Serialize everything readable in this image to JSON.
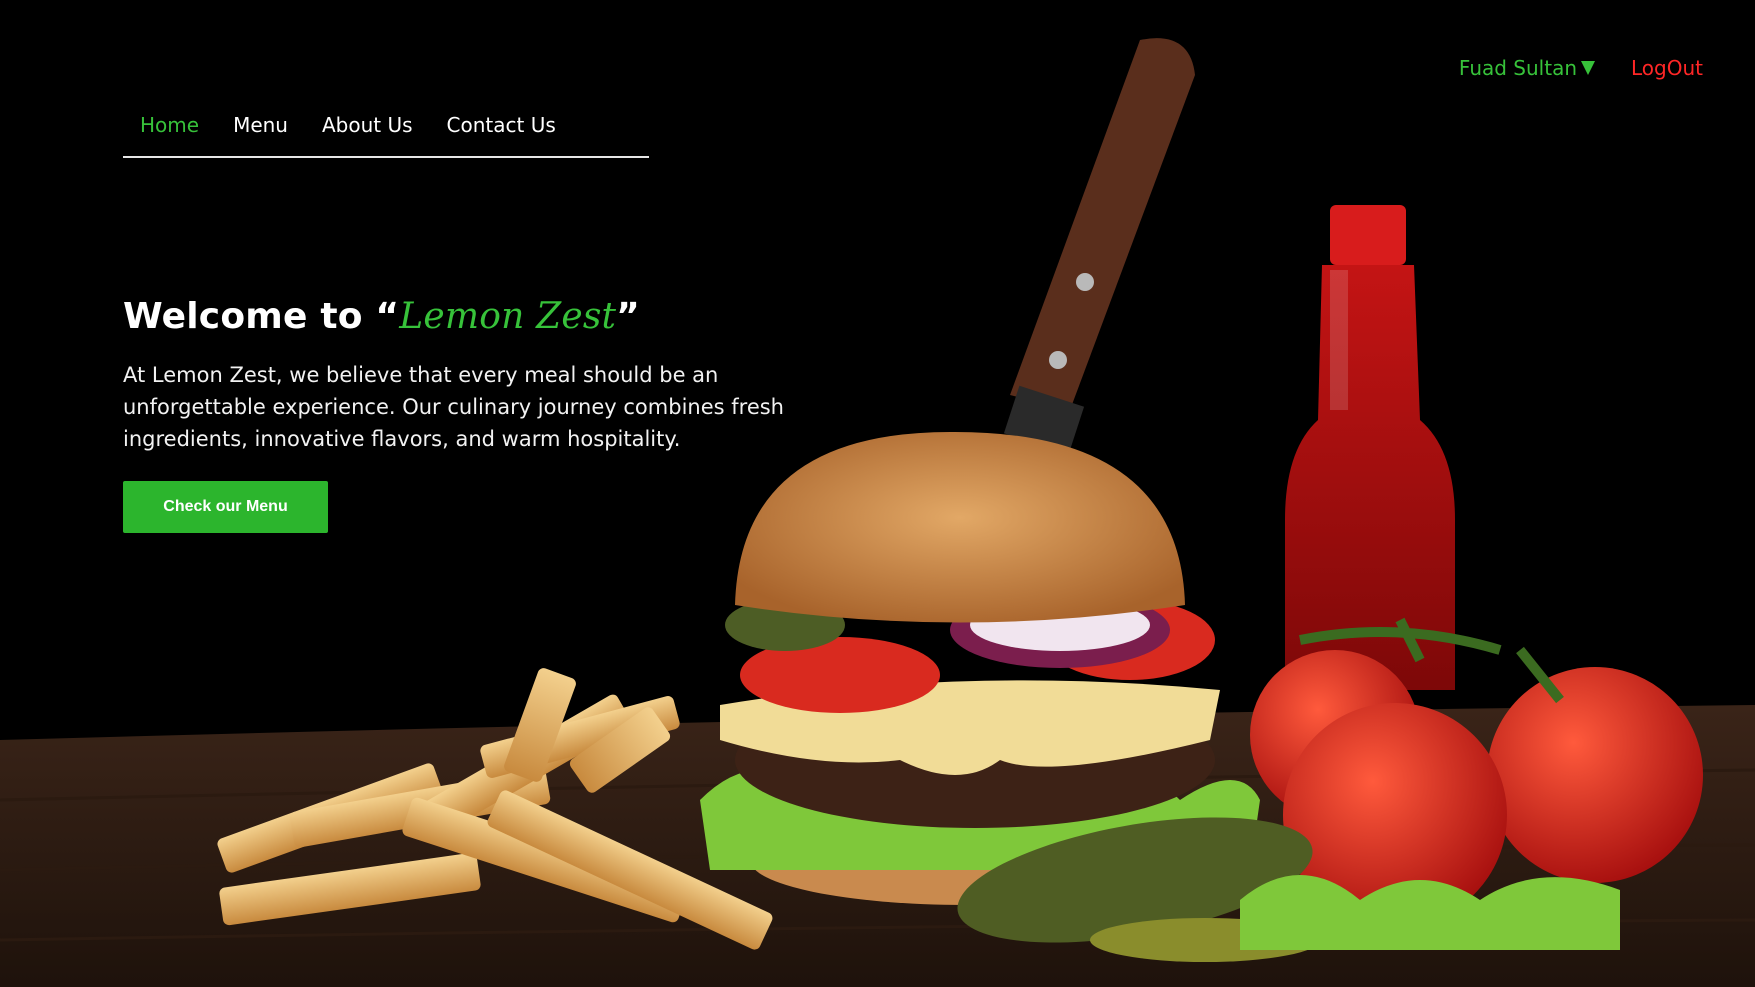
{
  "nav": {
    "items": [
      {
        "label": "Home",
        "active": true
      },
      {
        "label": "Menu",
        "active": false
      },
      {
        "label": "About Us",
        "active": false
      },
      {
        "label": "Contact Us",
        "active": false
      }
    ]
  },
  "user": {
    "name": "Fuad Sultan",
    "dropdown_icon": "caret-down-icon",
    "logout_label": "LogOut"
  },
  "hero": {
    "title_prefix": "Welcome to “",
    "brand": "Lemon Zest",
    "title_suffix": "”",
    "description": "At Lemon Zest, we believe that every meal should be an unforgettable experience. Our culinary journey combines fresh ingredients, innovative flavors, and warm hospitality.",
    "cta_label": "Check our Menu"
  },
  "colors": {
    "accent": "#37c23a",
    "button": "#2cb52d",
    "logout": "#ff2626",
    "background": "#000000"
  }
}
